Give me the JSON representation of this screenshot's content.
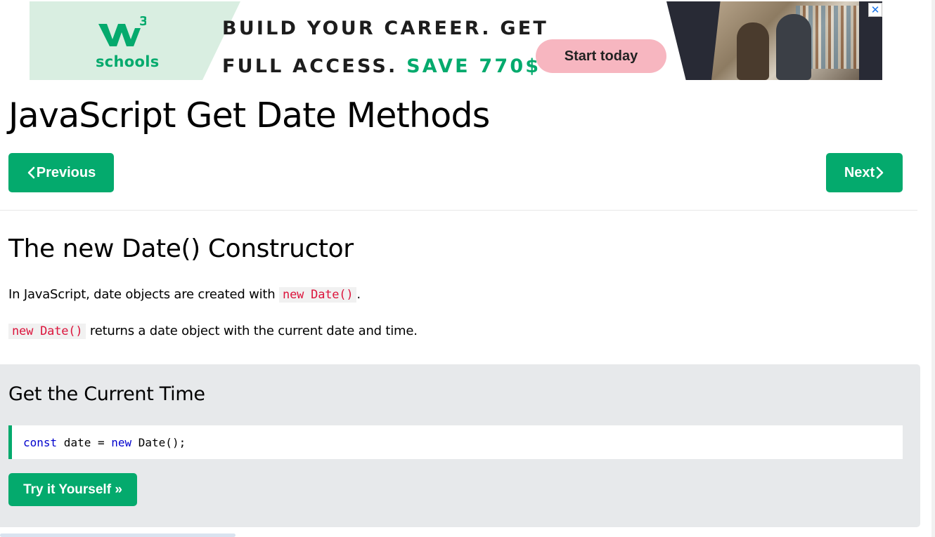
{
  "ad": {
    "logo_superscript": "3",
    "logo_text": "schools",
    "headline_line1": "BUILD YOUR CAREER. GET",
    "headline_line2_prefix": "FULL ACCESS.",
    "headline_line2_highlight": "SAVE 770$",
    "cta_label": "Start today",
    "close_glyph": "✕",
    "close_icon": "close-icon"
  },
  "header": {
    "title": "JavaScript Get Date Methods"
  },
  "nav": {
    "previous_label": "Previous",
    "next_label": "Next",
    "previous_icon": "chevron-left-icon",
    "next_icon": "chevron-right-icon"
  },
  "section": {
    "title": "The new Date() Constructor",
    "para1_text": "In JavaScript, date objects are created with",
    "para1_code": "new Date()",
    "para1_suffix": ".",
    "para2_code": "new Date()",
    "para2_text": "returns a date object with the current date and time."
  },
  "example": {
    "title": "Get the Current Time",
    "code_kw1": "const",
    "code_mid": " date = ",
    "code_kw2": "new",
    "code_end": " Date();",
    "try_label": "Try it Yourself »"
  },
  "colors": {
    "brand_green": "#04aa6d",
    "inline_code_red": "#dc143c",
    "example_bg": "#e7e9eb",
    "keyword_blue": "#0000cd"
  }
}
